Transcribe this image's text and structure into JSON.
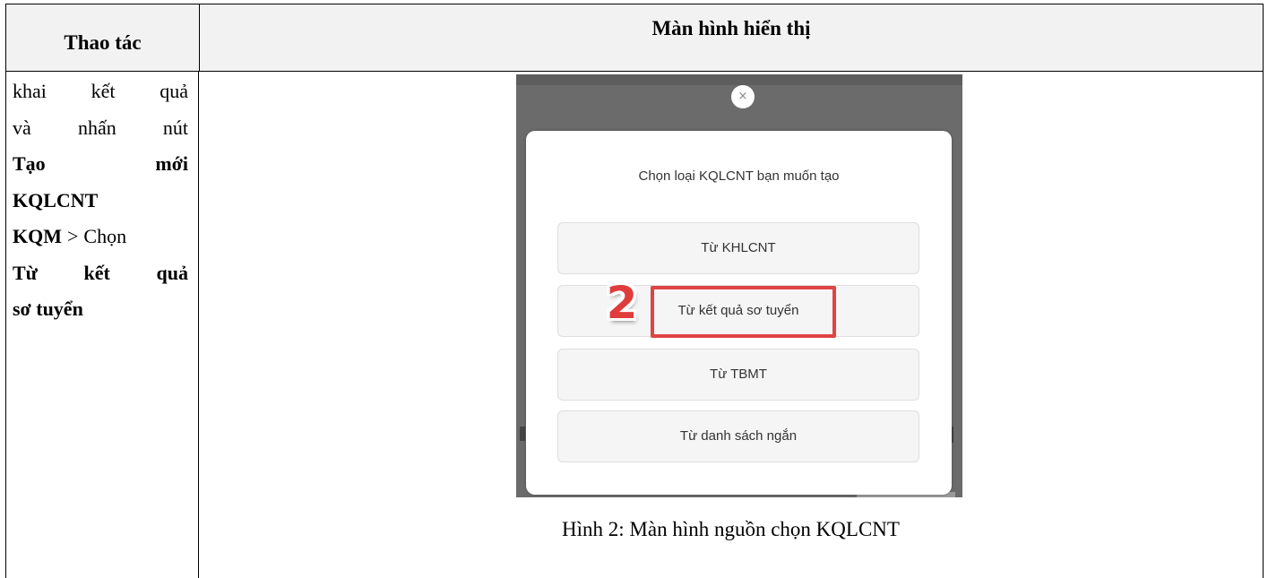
{
  "table": {
    "header_action": "Thao tác",
    "header_screen": "Màn hình hiển thị"
  },
  "action_lines": {
    "l1a": "khai",
    "l1b": "kết",
    "l1c": "quả",
    "l2a": "và",
    "l2b": "nhấn",
    "l2c": "nút",
    "l3a": "Tạo",
    "l3b": "mới",
    "l4": "KQLCNT",
    "l5a": "KQM",
    "l5b": ">",
    "l5c": "Chọn",
    "l6a": "Từ",
    "l6b": "kết",
    "l6c": "quả",
    "l7": "sơ tuyển"
  },
  "screenshot": {
    "close_label": "×",
    "modal_title": "Chọn loại KQLCNT bạn muốn tạo",
    "options": [
      "Từ KHLCNT",
      "Từ kết quả sơ tuyển",
      "Từ TBMT",
      "Từ danh sách ngắn"
    ],
    "step_number": "2",
    "highlight_color": "#e04343"
  },
  "caption": "Hình 2: Màn hình nguồn chọn KQLCNT"
}
